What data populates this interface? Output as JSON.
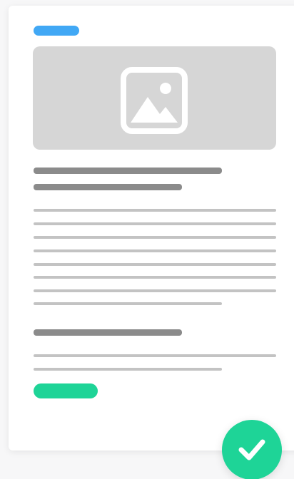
{
  "colors": {
    "tag": "#41a8f5",
    "cta": "#1ed497",
    "check": "#1ed497",
    "image_placeholder": "#d6d6d6",
    "title_line": "#8b8b8b",
    "body_line": "#c3c3c3"
  },
  "icons": {
    "image": "image-icon",
    "check": "checkmark-icon"
  }
}
